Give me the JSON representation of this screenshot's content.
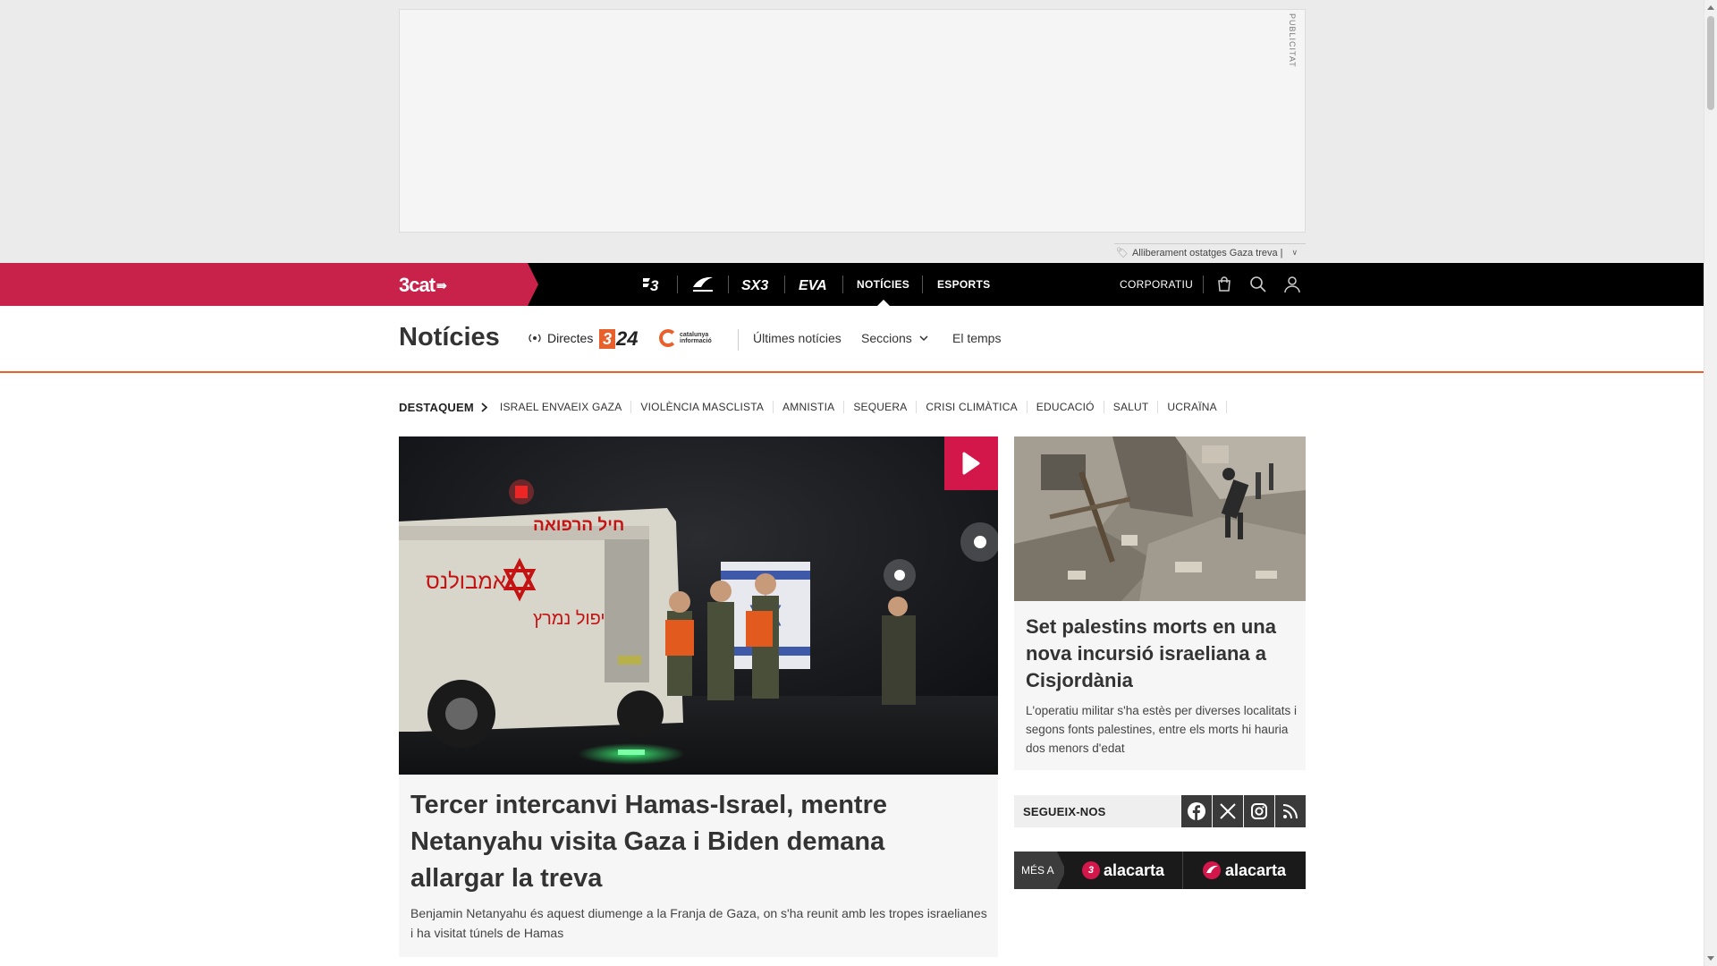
{
  "ad": {
    "label": "PUBLICITAT",
    "hint": "Alliberament ostatges Gaza treva |"
  },
  "topbar": {
    "brand": "3cat",
    "channels": [
      {
        "name": "tv3-icon",
        "label": "3"
      },
      {
        "name": "catradio-icon",
        "label": "CR"
      },
      {
        "name": "sx3-icon",
        "label": "SX3"
      },
      {
        "name": "eva-icon",
        "label": "EVA"
      }
    ],
    "nav_noticies": "NOTÍCIES",
    "nav_esports": "ESPORTS",
    "nav_corporatiu": "CORPORATIU",
    "colors": {
      "accent": "#c8224b",
      "bar": "#000000"
    }
  },
  "section": {
    "title": "Notícies",
    "directes": "Directes",
    "logo_324_box": "3",
    "logo_324_num": "24",
    "logo_ci_line1": "catalunya",
    "logo_ci_line2": "informació",
    "links": {
      "ultimes": "Últimes notícies",
      "seccions": "Seccions",
      "temps": "El temps"
    },
    "accent": "#e8612c"
  },
  "destaquem": {
    "label": "DESTAQUEM",
    "tags": [
      "ISRAEL ENVAEIX GAZA",
      "VIOLÈNCIA MASCLISTA",
      "AMNISTIA",
      "SEQUERA",
      "CRISI CLIMÀTICA",
      "EDUCACIÓ",
      "SALUT",
      "UCRAÏNA"
    ]
  },
  "main_article": {
    "title": "Tercer intercanvi Hamas-Israel, mentre Netanyahu visita Gaza i Biden demana allargar la treva",
    "lead": "Benjamin Netanyahu és aquest diumenge a la Franja de Gaza, on s'ha reunit amb les tropes israelianes i ha visitat túnels de Hamas",
    "ambulance_text_1": "חיל הרפואה",
    "ambulance_text_2": "אמבולנס",
    "ambulance_text_3": "טיפול נמרץ"
  },
  "side_article": {
    "title": "Set palestins morts en una nova incursió israeliana a Cisjordània",
    "lead": "L'operatiu militar s'ha estès per diverses localitats i segons fonts palestines, entre els morts hi hauria dos menors d'edat"
  },
  "follow": {
    "label": "SEGUEIX-NOS",
    "networks": [
      "facebook-icon",
      "x-icon",
      "instagram-icon",
      "rss-icon"
    ]
  },
  "mes_a": {
    "label": "MÉS A",
    "tv3_badge": "3",
    "tv3_alacarta": "alacarta",
    "radio_alacarta": "alacarta"
  }
}
